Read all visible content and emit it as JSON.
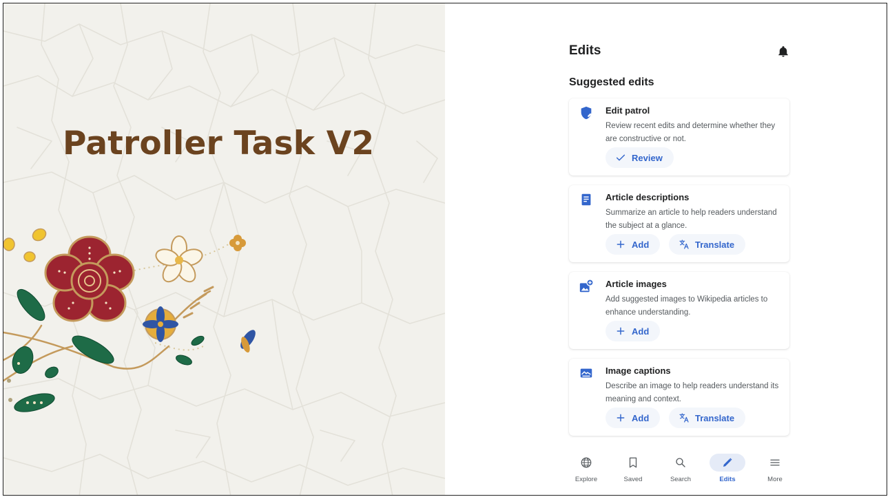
{
  "slide": {
    "title": "Patroller Task V2",
    "title_color": "#6b431f",
    "background_color": "#f2f1ec"
  },
  "app": {
    "header_title": "Edits",
    "notification_icon": "bell-icon",
    "section_title": "Suggested edits",
    "accent_color": "#3366cc",
    "cards": [
      {
        "icon": "shield-edit-icon",
        "title": "Edit patrol",
        "description": "Review recent edits and determine whether they are constructive or not.",
        "buttons": [
          {
            "icon": "check-icon",
            "label": "Review"
          }
        ]
      },
      {
        "icon": "article-description-icon",
        "title": "Article descriptions",
        "description": "Summarize an article to help readers understand the subject at a glance.",
        "buttons": [
          {
            "icon": "plus-icon",
            "label": "Add"
          },
          {
            "icon": "translate-icon",
            "label": "Translate"
          }
        ]
      },
      {
        "icon": "add-image-icon",
        "title": "Article images",
        "description": "Add suggested images to Wikipedia articles to enhance understanding.",
        "buttons": [
          {
            "icon": "plus-icon",
            "label": "Add"
          }
        ]
      },
      {
        "icon": "image-caption-icon",
        "title": "Image captions",
        "description": "Describe an image to help readers understand its meaning and context.",
        "buttons": [
          {
            "icon": "plus-icon",
            "label": "Add"
          },
          {
            "icon": "translate-icon",
            "label": "Translate"
          }
        ]
      }
    ],
    "nav": [
      {
        "icon": "globe-icon",
        "label": "Explore",
        "active": false
      },
      {
        "icon": "bookmark-icon",
        "label": "Saved",
        "active": false
      },
      {
        "icon": "search-icon",
        "label": "Search",
        "active": false
      },
      {
        "icon": "pencil-icon",
        "label": "Edits",
        "active": true
      },
      {
        "icon": "menu-icon",
        "label": "More",
        "active": false
      }
    ]
  }
}
